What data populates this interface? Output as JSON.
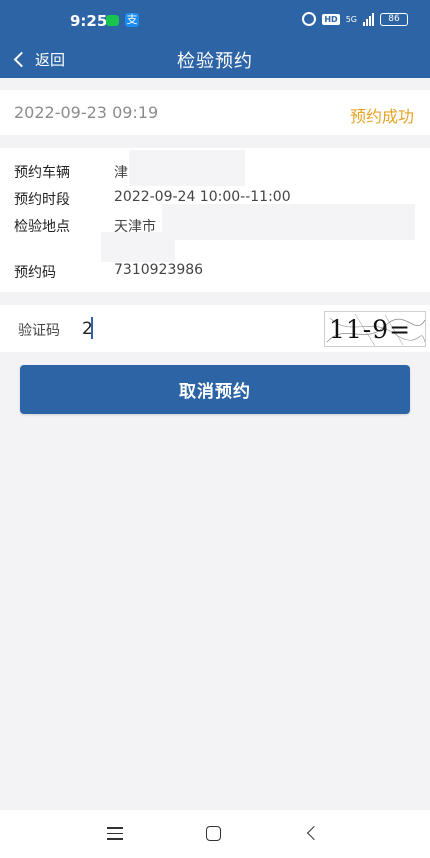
{
  "status_bar": {
    "time": "9:25",
    "app_icon_glyph": "支",
    "hd": "HD",
    "network": "5G",
    "battery": "86"
  },
  "nav": {
    "back_label": "返回",
    "title": "检验预约"
  },
  "order": {
    "datetime": "2022-09-23 09:19",
    "status": "预约成功",
    "status_color": "#e8a326"
  },
  "details": {
    "vehicle_label": "预约车辆",
    "vehicle_value": "津",
    "period_label": "预约时段",
    "period_value": "2022-09-24 10:00--11:00",
    "location_label": "检验地点",
    "location_value": "天津市",
    "code_label": "预约码",
    "code_value": "7310923986"
  },
  "captcha": {
    "label": "验证码",
    "input_value": "2",
    "image_text": "11-9="
  },
  "actions": {
    "cancel_label": "取消预约"
  },
  "theme": {
    "primary": "#2d64a6"
  }
}
